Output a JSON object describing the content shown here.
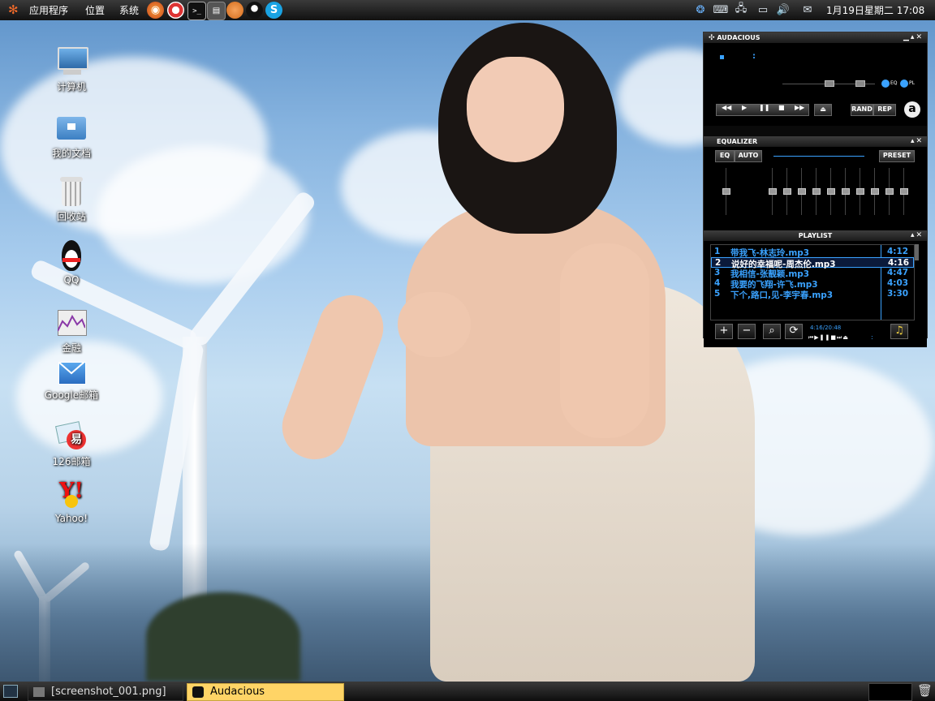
{
  "top_panel": {
    "menus": [
      "应用程序",
      "位置",
      "系统"
    ],
    "launchers": [
      "firefox-icon",
      "help-lifebuoy-icon",
      "terminal-icon",
      "radio-icon",
      "basketball-icon",
      "qq-icon",
      "skype-icon"
    ],
    "tray_icons": [
      "swirl-icon",
      "keyboard-icon",
      "network-icon",
      "battery-icon",
      "volume-icon",
      "mail-icon"
    ],
    "clock": "1月19日星期二 17:08"
  },
  "desktop_icons": [
    {
      "label": "计算机",
      "icon": "computer-icon"
    },
    {
      "label": "我的文档",
      "icon": "home-folder-icon"
    },
    {
      "label": "回收站",
      "icon": "trash-icon"
    },
    {
      "label": "QQ",
      "icon": "qq-penguin-icon"
    },
    {
      "label": "金融",
      "icon": "finance-chart-icon"
    },
    {
      "label": "Google邮箱",
      "icon": "gmail-icon"
    },
    {
      "label": "126邮箱",
      "icon": "126-mail-icon"
    },
    {
      "label": "Yahoo!",
      "icon": "yahoo-icon"
    }
  ],
  "audacious": {
    "main_title": "AUDACIOUS",
    "time_display": ":",
    "eq_toggle": "EQ",
    "pl_toggle": "PL",
    "rand_label": "RAND",
    "rep_label": "REP",
    "logo": "a",
    "equalizer_title": "EQUALIZER",
    "eq_button": "EQ",
    "auto_button": "AUTO",
    "preset_button": "PRESET",
    "playlist_title": "PLAYLIST",
    "playlist": [
      {
        "num": "1",
        "title": "带我飞-林志玲.mp3",
        "duration": "4:12"
      },
      {
        "num": "2",
        "title": "说好的幸福呢-周杰伦.mp3",
        "duration": "4:16"
      },
      {
        "num": "3",
        "title": "我相信-张靓颖.mp3",
        "duration": "4:47"
      },
      {
        "num": "4",
        "title": "我要的飞翔-许飞.mp3",
        "duration": "4:03"
      },
      {
        "num": "5",
        "title": "下个,路口,见-李宇春.mp3",
        "duration": "3:30"
      }
    ],
    "selected_index": 1,
    "playlist_time": "4:16/20:48",
    "mini_time": ":"
  },
  "taskbar": {
    "tasks": [
      {
        "label": "[screenshot_001.png]",
        "active": false
      },
      {
        "label": "Audacious",
        "active": true
      }
    ]
  },
  "colors": {
    "playlist_text": "#3aa2ff",
    "selected_task": "#ffd466",
    "panel": "#1b1b1b"
  }
}
